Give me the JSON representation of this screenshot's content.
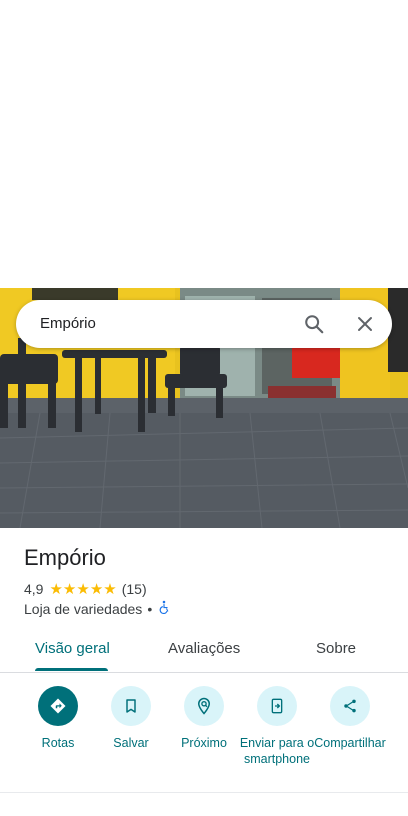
{
  "search": {
    "query": "Empório"
  },
  "place": {
    "name": "Empório",
    "rating": "4,9",
    "stars": 5,
    "reviews_count": "(15)",
    "category": "Loja de variedades",
    "separator": "•"
  },
  "tabs": [
    {
      "label": "Visão geral",
      "active": true
    },
    {
      "label": "Avaliações",
      "active": false
    },
    {
      "label": "Sobre",
      "active": false
    }
  ],
  "actions": [
    {
      "label": "Rotas",
      "icon": "directions-icon"
    },
    {
      "label": "Salvar",
      "icon": "bookmark-icon"
    },
    {
      "label": "Próximo",
      "icon": "nearby-icon"
    },
    {
      "label": "Enviar para o smartphone",
      "icon": "send-to-phone-icon"
    },
    {
      "label": "Compartilhar",
      "icon": "share-icon"
    }
  ],
  "colors": {
    "accent": "#00707a",
    "action_bg": "#d9f4f9",
    "star": "#fbbc04",
    "accessibility": "#1a73e8"
  }
}
